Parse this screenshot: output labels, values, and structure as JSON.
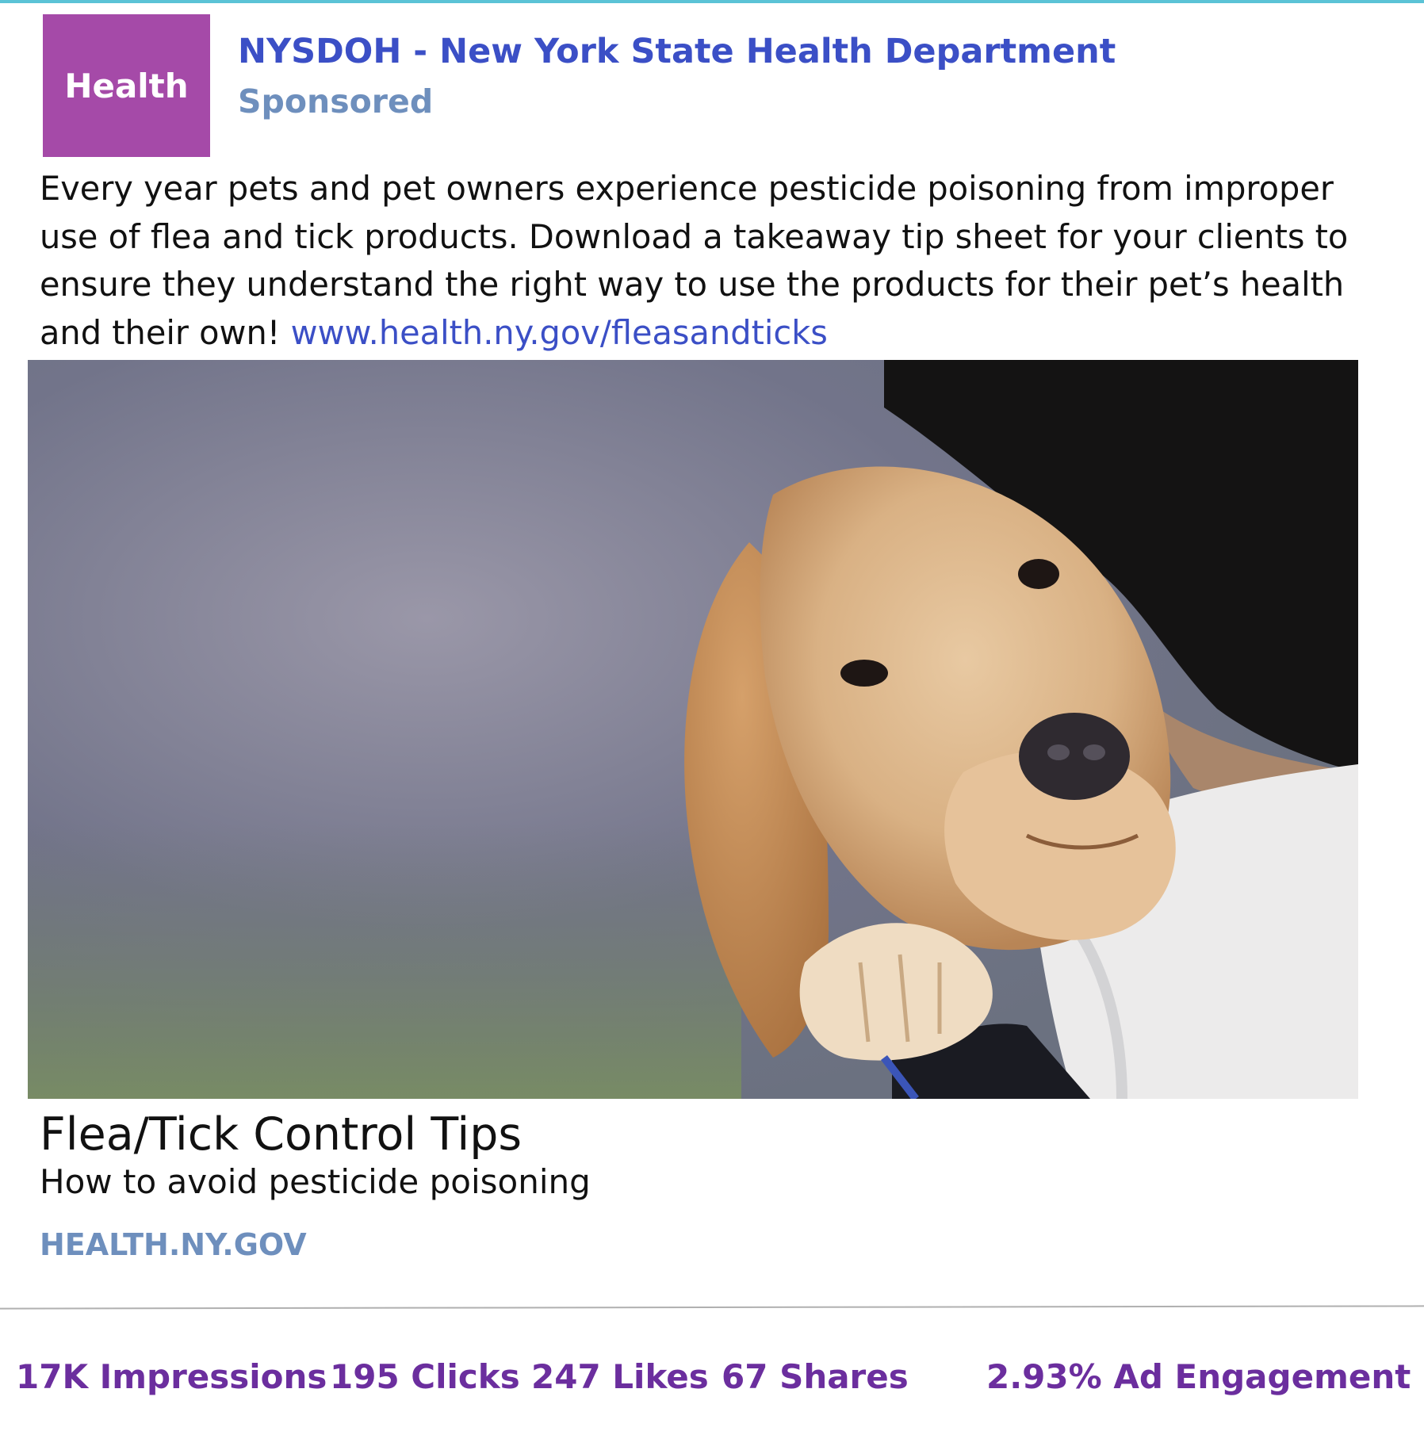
{
  "colors": {
    "accent_rule": "#5bc3d6",
    "logo_bg": "#a54aa8",
    "page_name": "#3b4fc6",
    "muted_blue": "#6e8fbd",
    "stat_purple": "#6b2e9e"
  },
  "post": {
    "logo_text": "Health",
    "page_name": "NYSDOH - New York State Health Department",
    "sponsored_label": "Sponsored",
    "body_text": "Every year pets and pet owners experience pesticide poisoning from improper use of flea and tick products. Download a takeaway tip sheet for your clients to ensure they understand the right way to use the products for their pet’s health and their own!",
    "link_text": "www.health.ny.gov/fleasandticks"
  },
  "link_preview": {
    "headline": "Flea/Tick Control Tips",
    "description": "How to avoid pesticide poisoning",
    "domain": "HEALTH.NY.GOV"
  },
  "stats": {
    "impressions": "17K Impressions",
    "clicks": "195 Clicks",
    "likes": "247 Likes",
    "shares": "67 Shares",
    "engagement": "2.93% Ad Engagement"
  }
}
